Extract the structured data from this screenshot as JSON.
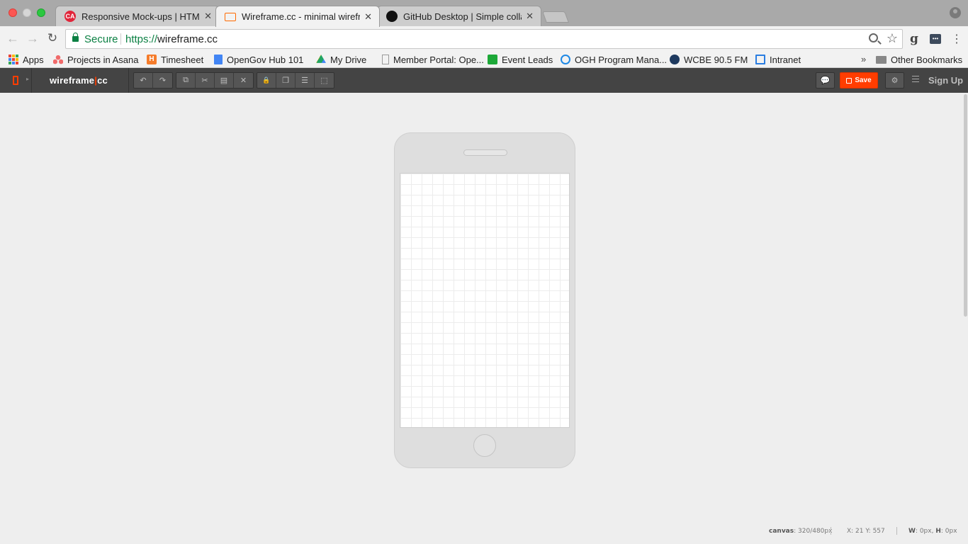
{
  "browser": {
    "tabs": [
      {
        "title": "Responsive Mock-ups | HTML, CSS, and Free Resources",
        "favicon": "ca-logo-icon",
        "favicon_text": "CA",
        "favicon_color": "#e1253a",
        "active": false
      },
      {
        "title": "Wireframe.cc - minimal wireframing tool",
        "favicon": "wireframe-logo-icon",
        "favicon_color": "#ff6a00",
        "active": true
      },
      {
        "title": "GitHub Desktop | Simple collaboration from your desktop",
        "favicon": "github-icon",
        "favicon_color": "#111111",
        "active": false
      }
    ],
    "tab_close_glyph": "✕",
    "nav": {
      "back_glyph": "←",
      "forward_glyph": "→",
      "reload_glyph": "↻"
    },
    "omnibox": {
      "secure_label": "Secure",
      "url_scheme": "https://",
      "url_host": "wireframe.cc",
      "secure_color": "#0b8043"
    },
    "extensions": {
      "grammarly_glyph": "g",
      "password_glyph": "•••",
      "menu_glyph": "⋮"
    },
    "bookmarks": [
      {
        "label": "Apps",
        "icon": "apps-grid-icon"
      },
      {
        "label": "Projects in Asana",
        "icon": "asana-icon",
        "color": "#f06a6a"
      },
      {
        "label": "Timesheet",
        "icon": "harvest-icon",
        "color": "#f57c2b"
      },
      {
        "label": "OpenGov Hub 101",
        "icon": "google-docs-icon",
        "color": "#4285f4"
      },
      {
        "label": "My Drive",
        "icon": "google-drive-icon",
        "color": "#1fa463"
      },
      {
        "label": "Member Portal: Ope...",
        "icon": "page-icon",
        "color": "#999999"
      },
      {
        "label": "Event Leads",
        "icon": "event-leads-icon",
        "color": "#1da838"
      },
      {
        "label": "OGH Program Mana...",
        "icon": "globe-icon",
        "color": "#1e88e5"
      },
      {
        "label": "WCBE 90.5 FM",
        "icon": "wcbe-icon",
        "color": "#1e3a5f"
      },
      {
        "label": "Intranet",
        "icon": "intranet-icon",
        "color": "#2a7de1"
      }
    ],
    "bookmarks_overflow_glyph": "»",
    "other_bookmarks": "Other Bookmarks"
  },
  "app": {
    "brand_left": "wireframe",
    "brand_sep": "|",
    "brand_right": "cc",
    "accent": "#ff3d00",
    "toolbar_groups": [
      [
        {
          "name": "undo-button",
          "glyph": "↶"
        },
        {
          "name": "redo-button",
          "glyph": "↷"
        }
      ],
      [
        {
          "name": "copy-button",
          "glyph": "⧉"
        },
        {
          "name": "cut-button",
          "glyph": "✂"
        },
        {
          "name": "paste-button",
          "glyph": "▤"
        },
        {
          "name": "delete-button",
          "glyph": "✕"
        }
      ],
      [
        {
          "name": "lock-button",
          "glyph": "🔒"
        },
        {
          "name": "arrange-button",
          "glyph": "❐"
        },
        {
          "name": "align-button",
          "glyph": "☰"
        },
        {
          "name": "select-all-button",
          "glyph": "⬚"
        }
      ]
    ],
    "comment_glyph": "💬",
    "save_label": "Save",
    "settings_glyph": "⚙",
    "signup_label": "Sign Up"
  },
  "status": {
    "canvas_label": "canvas",
    "canvas_value": ": 320/480px",
    "coords": "X: 21 Y: 557",
    "w_label": "W",
    "w_value": ": 0px, ",
    "h_label": "H",
    "h_value": ": 0px"
  }
}
